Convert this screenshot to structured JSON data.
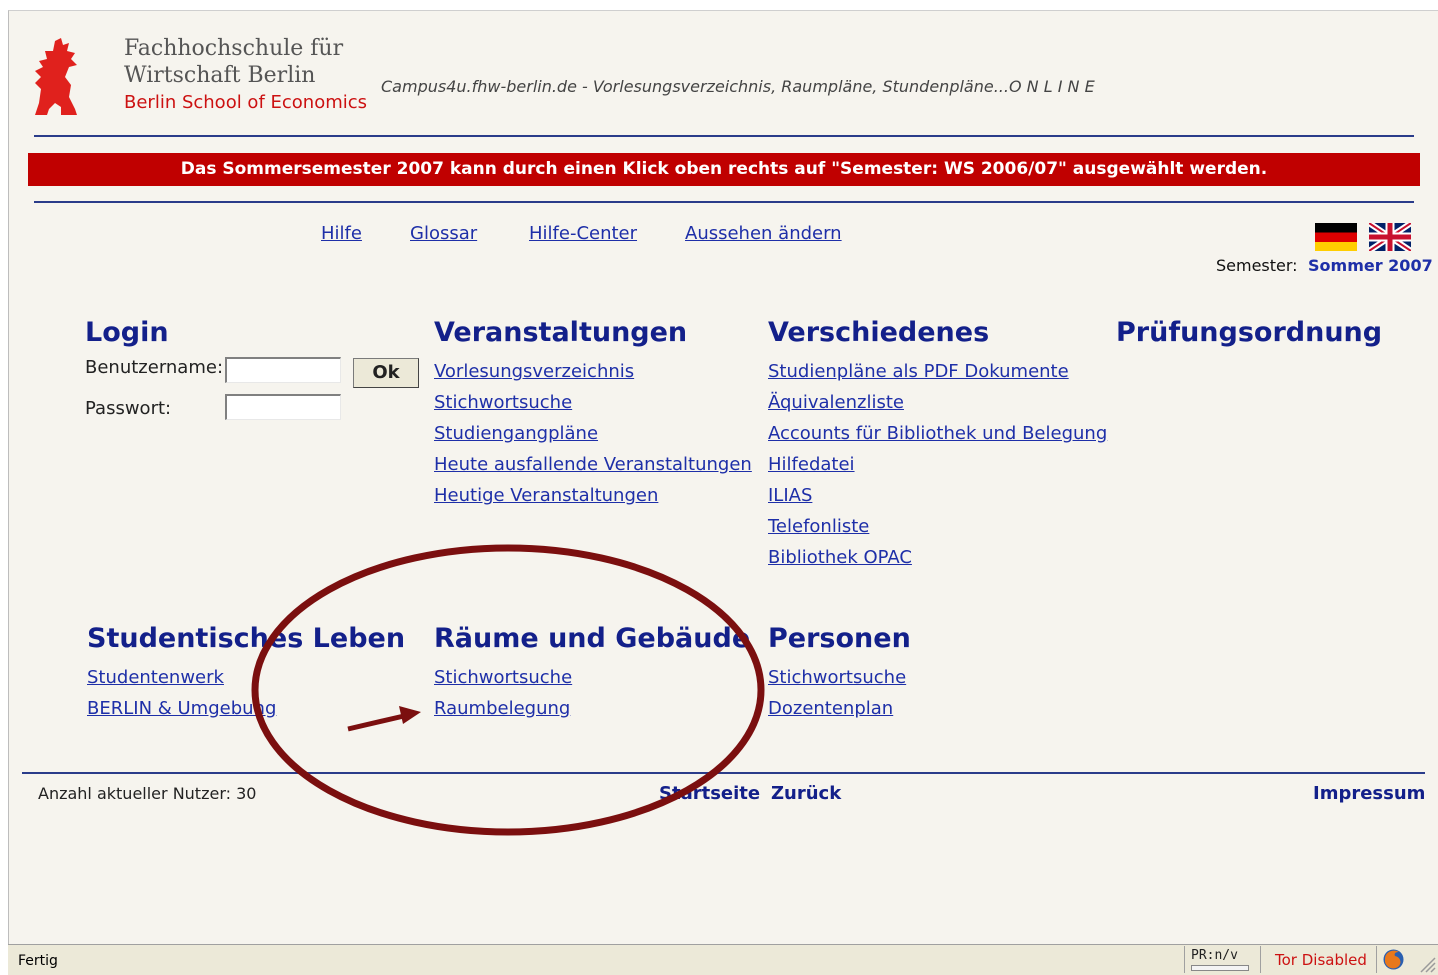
{
  "header": {
    "institution_line1": "Fachhochschule für",
    "institution_line2": "Wirtschaft Berlin",
    "institution_sub": "Berlin School of Economics",
    "tagline": "Campus4u.fhw-berlin.de - Vorlesungsverzeichnis, Raumpläne, Stundenpläne...O N L I N E"
  },
  "banner": {
    "text": "Das Sommersemester 2007 kann durch einen Klick oben rechts auf \"Semester: WS 2006/07\" ausgewählt werden."
  },
  "nav": {
    "items": [
      "Hilfe",
      "Glossar",
      "Hilfe-Center",
      "Aussehen ändern"
    ]
  },
  "semester": {
    "label": "Semester:",
    "value": "Sommer 2007"
  },
  "login": {
    "title": "Login",
    "username_label": "Benutzername:",
    "password_label": "Passwort:",
    "username_value": "",
    "password_value": "",
    "ok_label": "Ok"
  },
  "veranstaltungen": {
    "title": "Veranstaltungen",
    "links": [
      "Vorlesungsverzeichnis",
      "Stichwortsuche",
      "Studiengangpläne",
      "Heute ausfallende Veranstaltungen",
      "Heutige Veranstaltungen"
    ]
  },
  "verschiedenes": {
    "title": "Verschiedenes",
    "links": [
      "Studienpläne als PDF Dokumente",
      "Äquivalenzliste",
      "Accounts für Bibliothek und Belegung",
      "Hilfedatei",
      "ILIAS",
      "Telefonliste",
      "Bibliothek OPAC"
    ]
  },
  "pruefungsordnung": {
    "title": "Prüfungsordnung"
  },
  "studentisches_leben": {
    "title": "Studentisches Leben",
    "links": [
      "Studentenwerk",
      "BERLIN & Umgebung"
    ]
  },
  "raeume": {
    "title": "Räume und Gebäude",
    "links": [
      "Stichwortsuche",
      "Raumbelegung"
    ]
  },
  "personen": {
    "title": "Personen",
    "links": [
      "Stichwortsuche",
      "Dozentenplan"
    ]
  },
  "footer": {
    "users_text": "Anzahl aktueller Nutzer: 30",
    "startseite": "Startseite",
    "zurueck": "Zurück",
    "impressum": "Impressum"
  },
  "statusbar": {
    "status": "Fertig",
    "pr_label": "PR:n/v",
    "tor_label": "Tor Disabled"
  },
  "colors": {
    "link": "#1e2fa8",
    "heading": "#13208a",
    "banner": "#c00000",
    "annotation": "#7b0f0f",
    "tor_text": "#cc1111"
  },
  "icons": [
    "berlin-bear-logo-icon",
    "german-flag-icon",
    "uk-flag-icon",
    "firefox-icon"
  ]
}
